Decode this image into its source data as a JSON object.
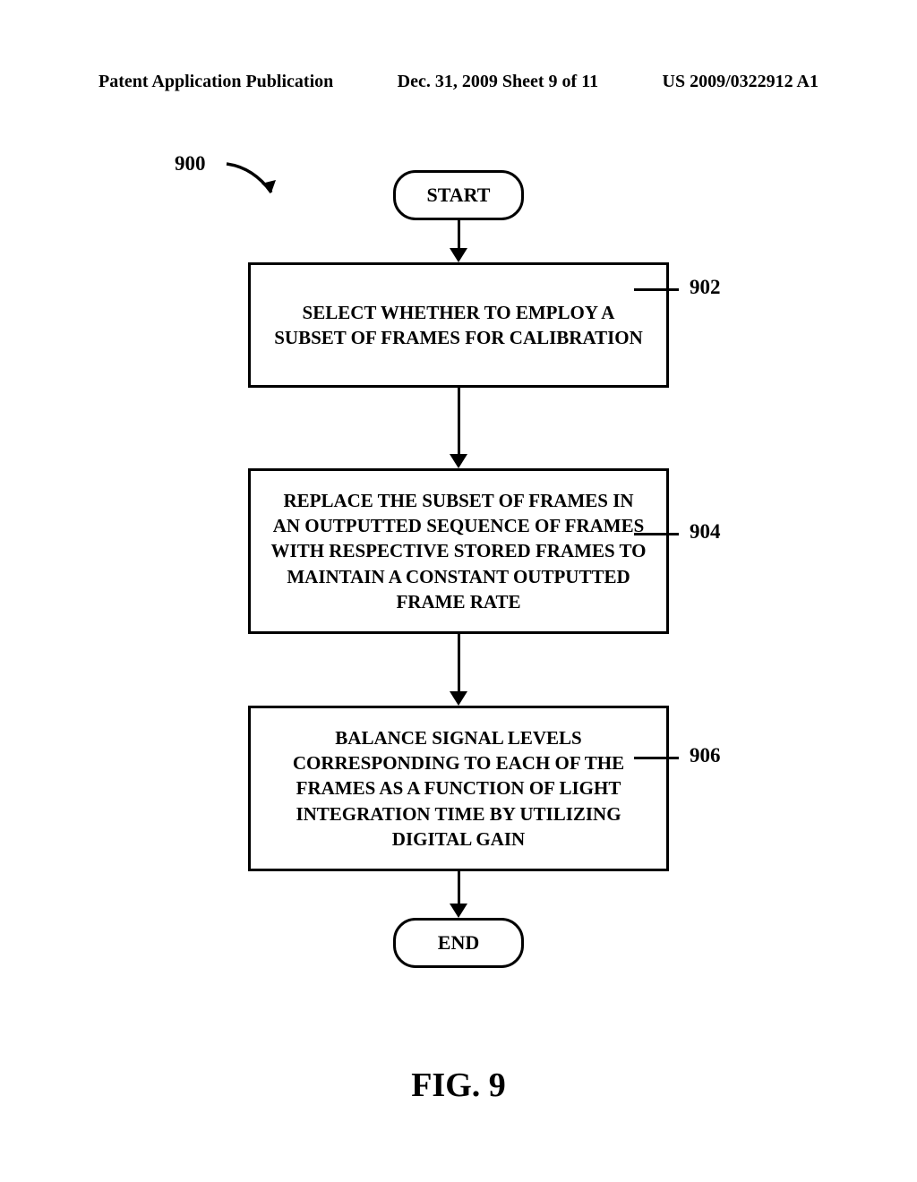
{
  "header": {
    "left": "Patent Application Publication",
    "center": "Dec. 31, 2009  Sheet 9 of 11",
    "right": "US 2009/0322912 A1"
  },
  "flow": {
    "ref_top": "900",
    "start": "START",
    "step1": {
      "text": "SELECT WHETHER TO EMPLOY A SUBSET OF FRAMES FOR CALIBRATION",
      "ref": "902"
    },
    "step2": {
      "text": "REPLACE THE SUBSET OF FRAMES IN AN OUTPUTTED SEQUENCE OF FRAMES WITH RESPECTIVE STORED FRAMES TO MAINTAIN A CONSTANT OUTPUTTED FRAME RATE",
      "ref": "904"
    },
    "step3": {
      "text": "BALANCE SIGNAL LEVELS CORRESPONDING TO EACH OF THE FRAMES AS A FUNCTION OF LIGHT INTEGRATION TIME BY UTILIZING DIGITAL GAIN",
      "ref": "906"
    },
    "end": "END"
  },
  "figure_label": "FIG. 9"
}
